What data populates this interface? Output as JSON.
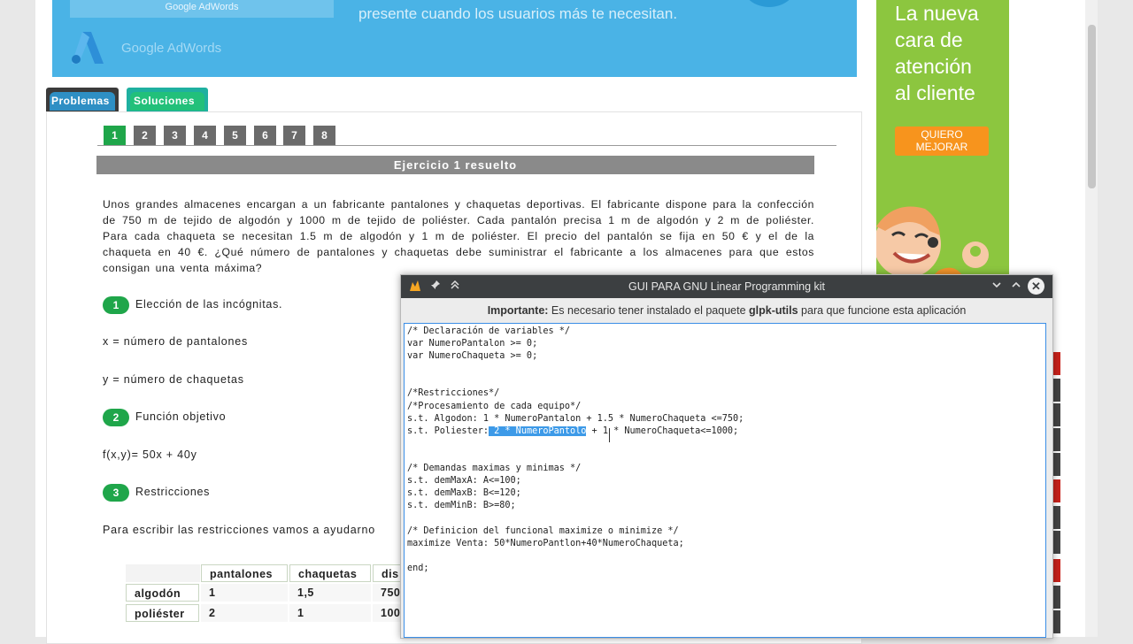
{
  "banner_top": {
    "strip_text": "Google AdWords",
    "brand": "Google AdWords",
    "tagline": "presente cuando los usuarios más te necesitan."
  },
  "ad_right": {
    "line1": "La nueva",
    "line2": "cara de",
    "line3": "atención",
    "line4": "al cliente",
    "button_line1": "QUIERO",
    "button_line2": "MEJORAR"
  },
  "tabs": {
    "problems": "Problemas",
    "solutions": "Soluciones"
  },
  "pagination": [
    "1",
    "2",
    "3",
    "4",
    "5",
    "6",
    "7",
    "8"
  ],
  "exercise_title": "Ejercicio 1 resuelto",
  "problem_text": "Unos grandes almacenes encargan a un fabricante pantalones y chaquetas deportivas. El fabricante dispone para la confección de 750 m de tejido de algodón y 1000 m de tejido de poliéster. Cada pantalón precisa 1 m de algodón y 2 m de poliéster. Para cada chaqueta se necesitan 1.5 m de algodón y 1 m de poliéster. El precio del pantalón se fija en 50 € y el de la chaqueta en 40 €. ¿Qué número de pantalones y chaquetas debe suministrar el fabricante a los almacenes para que estos consigan una venta máxima?",
  "steps": [
    {
      "num": "1",
      "label": "Elección de las incógnitas."
    },
    {
      "num": "2",
      "label": "Función objetivo"
    },
    {
      "num": "3",
      "label": "Restricciones"
    }
  ],
  "var_x": "x = número de pantalones",
  "var_y": "y = número de chaquetas",
  "objective": "f(x,y)= 50x + 40y",
  "restrictions_intro": "Para escribir las restricciones vamos a ayudarno",
  "table": {
    "headers": [
      "pantalones",
      "chaquetas",
      "dis"
    ],
    "rows": [
      {
        "label": "algodón",
        "values": [
          "1",
          "1,5",
          "750"
        ]
      },
      {
        "label": "poliéster",
        "values": [
          "2",
          "1",
          "100"
        ]
      }
    ]
  },
  "window": {
    "title": "GUI PARA GNU Linear Programming kit",
    "notice_bold1": "Importante:",
    "notice_text1": " Es necesario tener instalado el paquete ",
    "notice_bold2": "glpk-utils",
    "notice_text2": " para que funcione esta aplicación",
    "code_before": "/* Declaración de variables */\nvar NumeroPantalon >= 0;\nvar NumeroChaqueta >= 0;\n\n\n/*Restricciones*/\n/*Procesamiento de cada equipo*/\ns.t. Algodon: 1 * NumeroPantalon + 1.5 * NumeroChaqueta <=750;\ns.t. Poliester:",
    "code_selected": " 2 * NumeroPantolo",
    "code_after": " + 1 * NumeroChaqueta<=1000;\n\n\n/* Demandas maximas y minimas */\ns.t. demMaxA: A<=100;\ns.t. demMaxB: B<=120;\ns.t. demMinB: B>=80;\n\n/* Definicion del funcional maximize o minimize */\nmaximize Venta: 50*NumeroPantlon+40*NumeroChaqueta;\n\nend;"
  }
}
